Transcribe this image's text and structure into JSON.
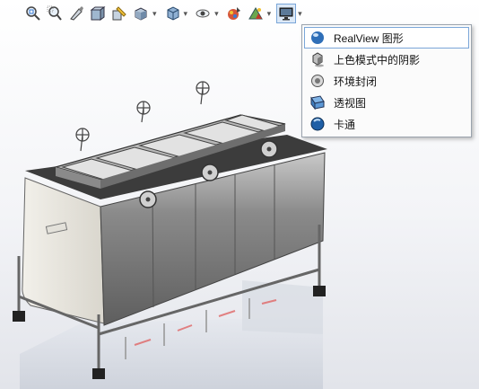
{
  "toolbar": {
    "buttons": [
      {
        "name": "zoom-to-fit-icon"
      },
      {
        "name": "zoom-to-area-icon"
      },
      {
        "name": "previous-view-icon"
      },
      {
        "name": "section-view-icon"
      },
      {
        "name": "dynamic-annotation-icon"
      },
      {
        "name": "view-orientation-icon"
      },
      {
        "name": "display-style-icon"
      },
      {
        "name": "hide-show-items-icon"
      },
      {
        "name": "edit-appearance-icon"
      },
      {
        "name": "apply-scene-icon"
      },
      {
        "name": "view-settings-icon"
      }
    ],
    "dropdown_glyph": "▾"
  },
  "menu": {
    "items": [
      {
        "label": "RealView 图形",
        "icon": "realview-sphere-icon"
      },
      {
        "label": "上色模式中的阴影",
        "icon": "shadows-cube-icon"
      },
      {
        "label": "环境封闭",
        "icon": "ambient-occlusion-icon"
      },
      {
        "label": "透视图",
        "icon": "perspective-icon"
      },
      {
        "label": "卡通",
        "icon": "cartoon-sphere-icon"
      }
    ]
  },
  "colors": {
    "accent": "#3a7bd5",
    "menu_border": "#9aa3ad",
    "selection_border": "#7aa6d8"
  }
}
